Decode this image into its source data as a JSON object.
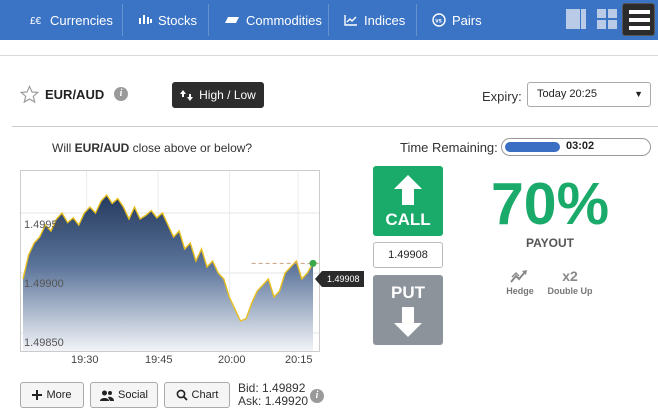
{
  "nav": {
    "items": [
      {
        "label": "Currencies",
        "icon": "currencies-icon"
      },
      {
        "label": "Stocks",
        "icon": "stocks-icon"
      },
      {
        "label": "Commodities",
        "icon": "commodities-icon"
      },
      {
        "label": "Indices",
        "icon": "indices-icon"
      },
      {
        "label": "Pairs",
        "icon": "pairs-icon"
      }
    ],
    "accent": "#3b74c5"
  },
  "trade": {
    "asset": "EUR/AUD",
    "option_type": "High / Low",
    "expiry_label": "Expiry:",
    "expiry_value": "Today 20:25",
    "question_prefix": "Will ",
    "question_asset": "EUR/AUD",
    "question_suffix": " close above or below?",
    "time_remaining_label": "Time Remaining:",
    "time_remaining": "03:02",
    "time_remaining_progress": 0.38,
    "call_label": "CALL",
    "put_label": "PUT",
    "strike": "1.49908",
    "payout_pct": "70%",
    "payout_label": "PAYOUT",
    "hedge_label": "Hedge",
    "double_label": "x2",
    "double_up_label": "Double Up",
    "call_color": "#1aaa69",
    "put_color": "#8c939b"
  },
  "chart_data": {
    "type": "area",
    "x": [
      "19:30",
      "19:45",
      "20:00",
      "20:15"
    ],
    "y_ticks": [
      "1.49950",
      "1.49900",
      "1.49850"
    ],
    "ylim": [
      1.49835,
      1.49985
    ],
    "current_price": "1.49908",
    "current_price_value": 1.49908,
    "series": [
      {
        "values": [
          1.49895,
          1.49915,
          1.49925,
          1.4993,
          1.4994,
          1.49935,
          1.49945,
          1.4995,
          1.49942,
          1.49946,
          1.4994,
          1.4995,
          1.49955,
          1.4995,
          1.4996,
          1.49965,
          1.49958,
          1.49962,
          1.49955,
          1.49945,
          1.49955,
          1.49945,
          1.49948,
          1.49952,
          1.49946,
          1.4995,
          1.4994,
          1.4993,
          1.49935,
          1.4992,
          1.49925,
          1.4991,
          1.4992,
          1.49905,
          1.4991,
          1.499,
          1.49895,
          1.4988,
          1.4987,
          1.4986,
          1.49862,
          1.49875,
          1.49885,
          1.4989,
          1.49895,
          1.4988,
          1.49885,
          1.499,
          1.49905,
          1.4991,
          1.49895,
          1.499,
          1.49908
        ]
      }
    ]
  },
  "footer": {
    "more_label": "More",
    "social_label": "Social",
    "chart_label": "Chart",
    "bid_label": "Bid:",
    "bid_value": "1.49892",
    "ask_label": "Ask:",
    "ask_value": "1.49920"
  }
}
